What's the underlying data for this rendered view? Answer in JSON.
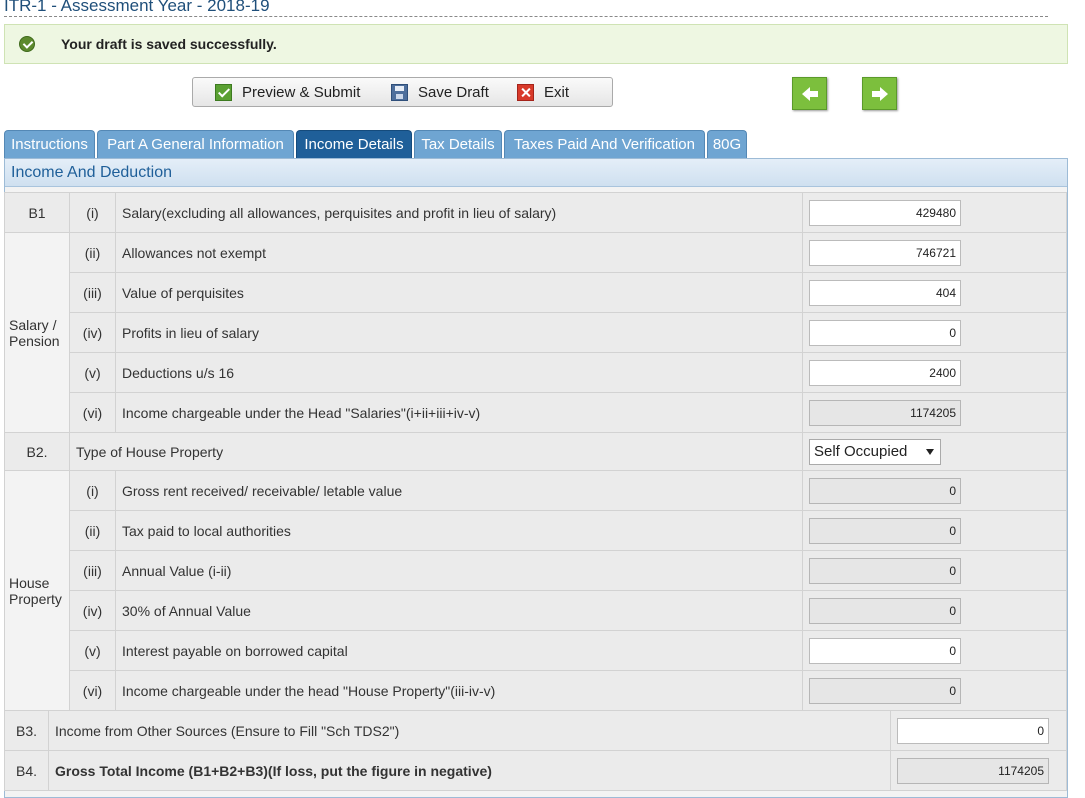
{
  "page": {
    "title": "ITR-1 - Assessment Year - 2018-19"
  },
  "alert": {
    "message": "Your draft is saved successfully."
  },
  "toolbar": {
    "preview_label": "Preview & Submit",
    "save_label": "Save Draft",
    "exit_label": "Exit"
  },
  "tabs": [
    {
      "label": "Instructions",
      "active": false
    },
    {
      "label": "Part A General Information",
      "active": false
    },
    {
      "label": "Income Details",
      "active": true
    },
    {
      "label": "Tax Details",
      "active": false
    },
    {
      "label": "Taxes Paid And Verification",
      "active": false
    },
    {
      "label": "80G",
      "active": false
    }
  ],
  "section": {
    "heading": "Income And Deduction"
  },
  "salary": {
    "code": "B1",
    "group_label": "Salary / Pension",
    "rows": [
      {
        "num": "(i)",
        "label": "Salary(excluding all allowances, perquisites and profit in lieu of salary)",
        "value": "429480",
        "readonly": false
      },
      {
        "num": "(ii)",
        "label": "Allowances not exempt",
        "value": "746721",
        "readonly": false
      },
      {
        "num": "(iii)",
        "label": "Value of perquisites",
        "value": "404",
        "readonly": false
      },
      {
        "num": "(iv)",
        "label": "Profits in lieu of salary",
        "value": "0",
        "readonly": false
      },
      {
        "num": "(v)",
        "label": "Deductions u/s 16",
        "value": "2400",
        "readonly": false
      },
      {
        "num": "(vi)",
        "label": "Income chargeable under the Head \"Salaries\"(i+ii+iii+iv-v)",
        "value": "1174205",
        "readonly": true
      }
    ]
  },
  "house": {
    "code": "B2.",
    "type_label": "Type of House Property",
    "type_value": "Self Occupied",
    "group_label": "House Property",
    "rows": [
      {
        "num": "(i)",
        "label": "Gross rent received/ receivable/ letable value",
        "value": "0",
        "readonly": true
      },
      {
        "num": "(ii)",
        "label": "Tax paid to local authorities",
        "value": "0",
        "readonly": true
      },
      {
        "num": "(iii)",
        "label": "Annual Value (i-ii)",
        "value": "0",
        "readonly": true
      },
      {
        "num": "(iv)",
        "label": "30% of Annual Value",
        "value": "0",
        "readonly": true
      },
      {
        "num": "(v)",
        "label": "Interest payable on borrowed capital",
        "value": "0",
        "readonly": false
      },
      {
        "num": "(vi)",
        "label": "Income chargeable under the head \"House Property\"(iii-iv-v)",
        "value": "0",
        "readonly": true
      }
    ]
  },
  "other": {
    "code": "B3.",
    "label": "Income from Other Sources (Ensure to Fill \"Sch TDS2\")",
    "value": "0"
  },
  "gross": {
    "code": "B4.",
    "label": "Gross Total Income (B1+B2+B3)(If loss, put the figure in negative)",
    "value": "1174205"
  },
  "colors": {
    "tab": "#6fa5d2",
    "tab_active": "#1f5f99",
    "nav_arrow": "#7cbf3d",
    "alert_bg": "#eef7e2"
  }
}
